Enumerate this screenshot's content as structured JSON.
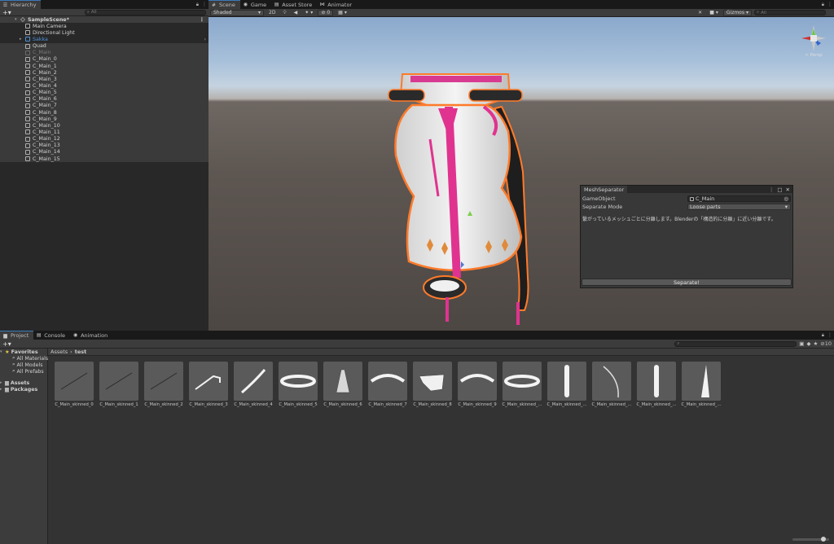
{
  "hierarchy": {
    "tab": "Hierarchy",
    "search_placeholder": "All",
    "items": [
      {
        "label": "SampleScene*",
        "kind": "scene",
        "depth": 0
      },
      {
        "label": "Main Camera",
        "kind": "normal",
        "depth": 1
      },
      {
        "label": "Directional Light",
        "kind": "normal",
        "depth": 1
      },
      {
        "label": "Sakka",
        "kind": "prefab",
        "depth": 1
      },
      {
        "label": "Quad",
        "kind": "selected",
        "depth": 1
      },
      {
        "label": "C_Main",
        "kind": "disabled",
        "depth": 1
      },
      {
        "label": "C_Main_0",
        "kind": "normal",
        "depth": 1
      },
      {
        "label": "C_Main_1",
        "kind": "normal",
        "depth": 1
      },
      {
        "label": "C_Main_2",
        "kind": "normal",
        "depth": 1
      },
      {
        "label": "C_Main_3",
        "kind": "normal",
        "depth": 1
      },
      {
        "label": "C_Main_4",
        "kind": "normal",
        "depth": 1
      },
      {
        "label": "C_Main_5",
        "kind": "normal",
        "depth": 1
      },
      {
        "label": "C_Main_6",
        "kind": "normal",
        "depth": 1
      },
      {
        "label": "C_Main_7",
        "kind": "normal",
        "depth": 1
      },
      {
        "label": "C_Main_8",
        "kind": "normal",
        "depth": 1
      },
      {
        "label": "C_Main_9",
        "kind": "normal",
        "depth": 1
      },
      {
        "label": "C_Main_10",
        "kind": "normal",
        "depth": 1
      },
      {
        "label": "C_Main_11",
        "kind": "normal",
        "depth": 1
      },
      {
        "label": "C_Main_12",
        "kind": "normal",
        "depth": 1
      },
      {
        "label": "C_Main_13",
        "kind": "normal",
        "depth": 1
      },
      {
        "label": "C_Main_14",
        "kind": "normal",
        "depth": 1
      },
      {
        "label": "C_Main_15",
        "kind": "normal",
        "depth": 1
      }
    ]
  },
  "scene": {
    "tabs": [
      {
        "label": "Scene",
        "icon": "grid-icon"
      },
      {
        "label": "Game",
        "icon": "gamepad-icon"
      },
      {
        "label": "Asset Store",
        "icon": "bag-icon"
      },
      {
        "label": "Animator",
        "icon": "animator-icon"
      }
    ],
    "shading_mode": "Shaded",
    "mode_2d": "2D",
    "hidden_count": "0",
    "gizmos_label": "Gizmos",
    "search_placeholder": "All",
    "persp_label": "< Persp",
    "accent": "#e0338f"
  },
  "mesh_separator": {
    "title": "MeshSeparator",
    "gameobject_label": "GameObject",
    "gameobject_value": "C_Main",
    "mode_label": "Separate Mode",
    "mode_value": "Loose parts",
    "description": "繋がっているメッシュごとに分離します。Blenderの「構造的に分離」に近い分離です。",
    "button": "Separate!"
  },
  "bottom": {
    "tabs": [
      {
        "label": "Project",
        "icon": "folder-icon"
      },
      {
        "label": "Console",
        "icon": "console-icon"
      },
      {
        "label": "Animation",
        "icon": "animation-icon"
      }
    ],
    "favorites": {
      "label": "Favorites",
      "items": [
        "All Materials",
        "All Models",
        "All Prefabs"
      ]
    },
    "roots": [
      "Assets",
      "Packages"
    ],
    "breadcrumb": [
      "Assets",
      "test"
    ],
    "hidden_count": "10",
    "assets": [
      "C_Main_skinned_0",
      "C_Main_skinned_1",
      "C_Main_skinned_2",
      "C_Main_skinned_3",
      "C_Main_skinned_4",
      "C_Main_skinned_5",
      "C_Main_skinned_6",
      "C_Main_skinned_7",
      "C_Main_skinned_8",
      "C_Main_skinned_9",
      "C_Main_skinned_...",
      "C_Main_skinned_...",
      "C_Main_skinned_...",
      "C_Main_skinned_...",
      "C_Main_skinned_..."
    ],
    "thumb_shapes": [
      "line",
      "line",
      "line",
      "hook",
      "stroke",
      "band",
      "figure",
      "arc",
      "wrap",
      "arc",
      "band",
      "bar",
      "curve",
      "bar",
      "horn",
      "ring"
    ]
  }
}
